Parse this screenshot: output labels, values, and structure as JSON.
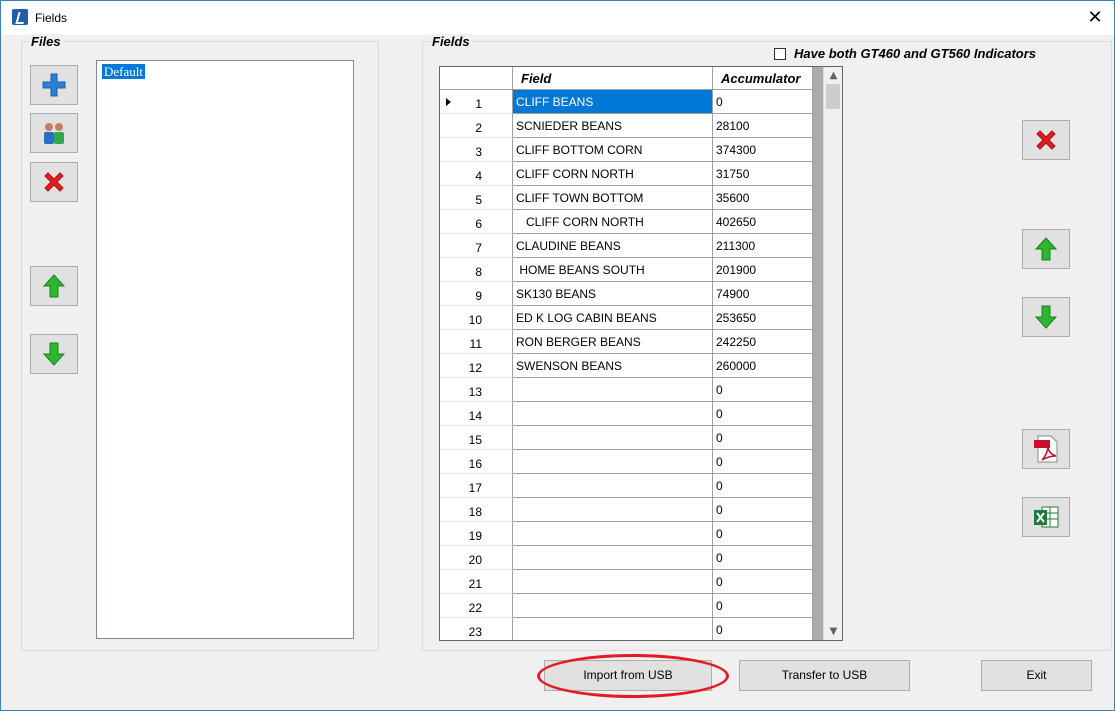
{
  "window": {
    "title": "Fields",
    "close_glyph": "✕"
  },
  "files_group": {
    "label": "Files",
    "toolbar": [
      {
        "name": "add-icon",
        "color": "#2a7fd4"
      },
      {
        "name": "users-icon"
      },
      {
        "name": "delete-icon",
        "color": "#e31c24"
      },
      {
        "name": "up-arrow-icon",
        "color": "#2fb62f"
      },
      {
        "name": "down-arrow-icon",
        "color": "#2fb62f"
      }
    ],
    "items": [
      {
        "label": "Default",
        "selected": true
      }
    ]
  },
  "fields_group": {
    "label": "Fields",
    "checkbox": {
      "label": "Have both GT460 and GT560 Indicators",
      "checked": false
    },
    "columns": {
      "row": "",
      "field": "Field",
      "accumulator": "Accumulator"
    },
    "rows": [
      {
        "n": "1",
        "field": "CLIFF BEANS",
        "acc": "0",
        "selected": true
      },
      {
        "n": "2",
        "field": "SCNIEDER BEANS",
        "acc": "28100"
      },
      {
        "n": "3",
        "field": "CLIFF BOTTOM CORN",
        "acc": "374300"
      },
      {
        "n": "4",
        "field": "CLIFF CORN NORTH",
        "acc": "31750"
      },
      {
        "n": "5",
        "field": "CLIFF TOWN BOTTOM",
        "acc": "35600"
      },
      {
        "n": "6",
        "field": "   CLIFF CORN NORTH",
        "acc": "402650"
      },
      {
        "n": "7",
        "field": "CLAUDINE BEANS",
        "acc": "211300"
      },
      {
        "n": "8",
        "field": " HOME BEANS SOUTH",
        "acc": "201900"
      },
      {
        "n": "9",
        "field": "SK130 BEANS",
        "acc": "74900"
      },
      {
        "n": "10",
        "field": "ED K LOG CABIN BEANS",
        "acc": "253650"
      },
      {
        "n": "11",
        "field": "RON BERGER BEANS",
        "acc": "242250"
      },
      {
        "n": "12",
        "field": "SWENSON BEANS",
        "acc": "260000"
      },
      {
        "n": "13",
        "field": "",
        "acc": "0"
      },
      {
        "n": "14",
        "field": "",
        "acc": "0"
      },
      {
        "n": "15",
        "field": "",
        "acc": "0"
      },
      {
        "n": "16",
        "field": "",
        "acc": "0"
      },
      {
        "n": "17",
        "field": "",
        "acc": "0"
      },
      {
        "n": "18",
        "field": "",
        "acc": "0"
      },
      {
        "n": "19",
        "field": "",
        "acc": "0"
      },
      {
        "n": "20",
        "field": "",
        "acc": "0"
      },
      {
        "n": "21",
        "field": "",
        "acc": "0"
      },
      {
        "n": "22",
        "field": "",
        "acc": "0"
      },
      {
        "n": "23",
        "field": "",
        "acc": "0"
      }
    ],
    "side_toolbar": [
      {
        "name": "delete-icon",
        "color": "#e31c24"
      },
      {
        "name": "up-arrow-icon",
        "color": "#2fb62f"
      },
      {
        "name": "down-arrow-icon",
        "color": "#2fb62f"
      },
      {
        "name": "pdf-icon",
        "color": "#c8102e"
      },
      {
        "name": "excel-icon",
        "color": "#1d7a3a"
      }
    ]
  },
  "buttons": {
    "import": "Import from USB",
    "transfer": "Transfer to USB",
    "exit": "Exit"
  },
  "annotation": {
    "color": "#e31c24"
  }
}
